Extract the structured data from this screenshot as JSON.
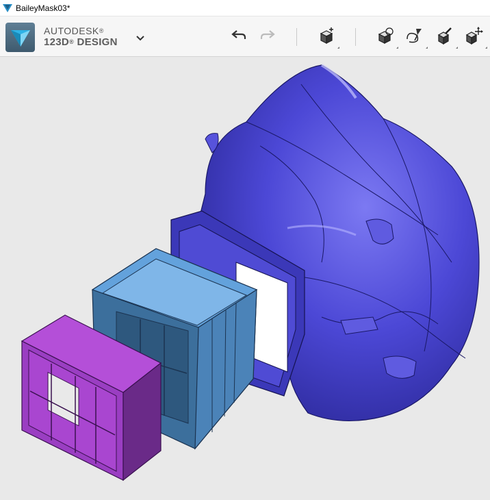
{
  "window": {
    "title": "BaileyMask03*"
  },
  "brand": {
    "line1": "AUTODESK",
    "line1_mark": "®",
    "line2": "123D",
    "line2_mark": "®",
    "line3": " DESIGN"
  },
  "toolbar": {
    "undo": "undo-icon",
    "redo": "redo-icon",
    "primitives": "primitive-box-icon",
    "sketch": "sketch-icon",
    "construct": "construct-icon",
    "modify": "modify-icon",
    "transform": "transform-icon"
  },
  "colors": {
    "mask": "#4a46d0",
    "filter_housing": "#5b9ad6",
    "filter_cap": "#a443cc",
    "viewport_bg": "#e9e9e9",
    "logo_accent": "#29a3d8"
  }
}
